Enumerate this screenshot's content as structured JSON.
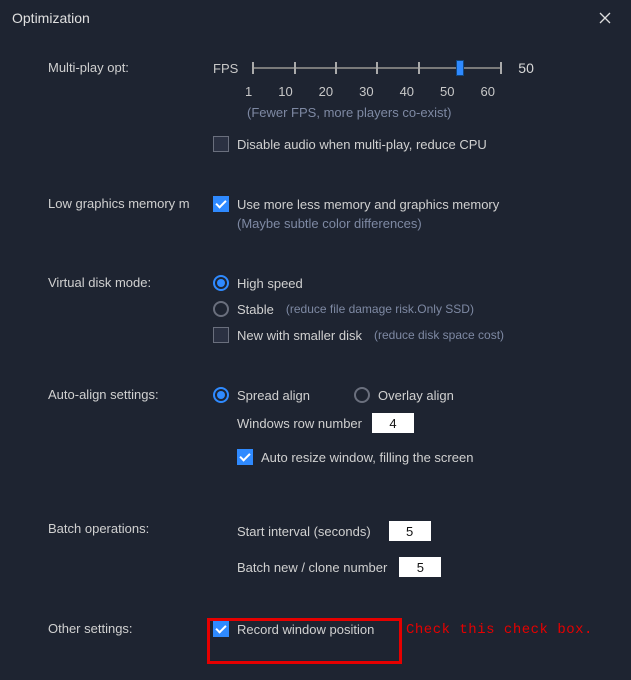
{
  "window": {
    "title": "Optimization"
  },
  "multi": {
    "label": "Multi-play opt:",
    "fps_prefix": "FPS",
    "fps_value": "50",
    "ticks": [
      "1",
      "10",
      "20",
      "30",
      "40",
      "50",
      "60"
    ],
    "hint": "(Fewer FPS, more players co-exist)",
    "disable_audio": "Disable audio when multi-play, reduce CPU"
  },
  "lowgfx": {
    "label": "Low graphics memory m",
    "cb": "Use more less memory and graphics memory",
    "hint": "(Maybe subtle color differences)"
  },
  "vdisk": {
    "label": "Virtual disk mode:",
    "high": "High speed",
    "stable": "Stable",
    "stable_hint": "(reduce file damage risk.Only SSD)",
    "new_small": "New with smaller disk",
    "new_small_hint": "(reduce disk space cost)"
  },
  "align": {
    "label": "Auto-align settings:",
    "spread": "Spread align",
    "overlay": "Overlay align",
    "rownum_label": "Windows row number",
    "rownum_value": "4",
    "autoresize": "Auto resize window, filling the screen"
  },
  "batch": {
    "label": "Batch operations:",
    "start_label": "Start interval (seconds)",
    "start_value": "5",
    "clone_label": "Batch new / clone number",
    "clone_value": "5"
  },
  "other": {
    "label": "Other settings:",
    "record": "Record window position"
  },
  "annotation": "Check this check box."
}
